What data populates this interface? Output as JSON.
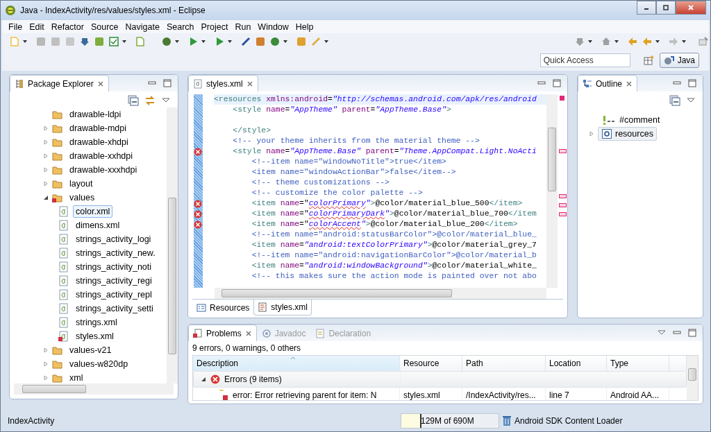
{
  "window": {
    "title": "Java - IndexActivity/res/values/styles.xml - Eclipse"
  },
  "menu": [
    "File",
    "Edit",
    "Refactor",
    "Source",
    "Navigate",
    "Search",
    "Project",
    "Run",
    "Window",
    "Help"
  ],
  "quick_access": {
    "placeholder": "Quick Access"
  },
  "perspective": {
    "label": "Java",
    "selected": true
  },
  "package_explorer": {
    "title": "Package Explorer",
    "tree": [
      {
        "label": "drawable-ldpi",
        "kind": "folder",
        "error": false,
        "selected": false
      },
      {
        "label": "drawable-mdpi",
        "kind": "folder",
        "expanded": false,
        "error": false,
        "selected": false
      },
      {
        "label": "drawable-xhdpi",
        "kind": "folder",
        "expanded": false,
        "error": false,
        "selected": false
      },
      {
        "label": "drawable-xxhdpi",
        "kind": "folder",
        "expanded": false,
        "error": false,
        "selected": false
      },
      {
        "label": "drawable-xxxhdpi",
        "kind": "folder",
        "expanded": false,
        "error": false,
        "selected": false
      },
      {
        "label": "layout",
        "kind": "folder",
        "expanded": false,
        "error": false,
        "selected": false
      },
      {
        "label": "values",
        "kind": "folder",
        "expanded": true,
        "error": true,
        "selected": false,
        "children": [
          {
            "label": "color.xml",
            "kind": "file",
            "error": false,
            "selected": true
          },
          {
            "label": "dimens.xml",
            "kind": "file",
            "error": false,
            "selected": false
          },
          {
            "label": "strings_activity_logi",
            "kind": "file",
            "error": false,
            "selected": false
          },
          {
            "label": "strings_activity_new.",
            "kind": "file",
            "error": false,
            "selected": false
          },
          {
            "label": "strings_activity_noti",
            "kind": "file",
            "error": false,
            "selected": false
          },
          {
            "label": "strings_activity_regi",
            "kind": "file",
            "error": false,
            "selected": false
          },
          {
            "label": "strings_activity_repl",
            "kind": "file",
            "error": false,
            "selected": false
          },
          {
            "label": "strings_activity_setti",
            "kind": "file",
            "error": false,
            "selected": false
          },
          {
            "label": "strings.xml",
            "kind": "file",
            "error": false,
            "selected": false
          },
          {
            "label": "styles.xml",
            "kind": "file",
            "error": true,
            "selected": false
          }
        ]
      },
      {
        "label": "values-v21",
        "kind": "folder",
        "expanded": false,
        "error": false,
        "selected": false
      },
      {
        "label": "values-w820dp",
        "kind": "folder",
        "expanded": false,
        "error": false,
        "selected": false
      },
      {
        "label": "xml",
        "kind": "folder",
        "expanded": false,
        "error": false,
        "selected": false
      }
    ]
  },
  "editor": {
    "tabs": [
      {
        "label": "styles.xml",
        "selected": true
      }
    ],
    "lines": [
      {
        "kind": "code",
        "error": false,
        "current": true,
        "segments": [
          {
            "kind": "tag",
            "text": "<resources"
          },
          {
            "kind": "attr",
            "text": " xmlns:android"
          },
          {
            "kind": "text",
            "text": "="
          },
          {
            "kind": "value",
            "text": "\"http://schemas.android.com/apk/res/android"
          }
        ]
      },
      {
        "kind": "code",
        "error": false,
        "current": false,
        "segments": [
          {
            "kind": "tag",
            "text": "    <style"
          },
          {
            "kind": "attr",
            "text": " name"
          },
          {
            "kind": "text",
            "text": "="
          },
          {
            "kind": "value",
            "text": "\"AppTheme\""
          },
          {
            "kind": "attr",
            "text": " parent"
          },
          {
            "kind": "text",
            "text": "="
          },
          {
            "kind": "value",
            "text": "\"AppTheme.Base\""
          },
          {
            "kind": "tag",
            "text": ">"
          }
        ]
      },
      {
        "kind": "blank"
      },
      {
        "kind": "code",
        "error": false,
        "current": false,
        "segments": [
          {
            "kind": "tag",
            "text": "    </style>"
          }
        ]
      },
      {
        "kind": "code",
        "error": false,
        "current": false,
        "segments": [
          {
            "kind": "comment",
            "text": "    <!-- your theme inherits from the material theme -->"
          }
        ]
      },
      {
        "kind": "code",
        "error": true,
        "current": false,
        "segments": [
          {
            "kind": "tag",
            "text": "    <style"
          },
          {
            "kind": "attr",
            "text": " name"
          },
          {
            "kind": "text",
            "text": "="
          },
          {
            "kind": "value",
            "text": "\"AppTheme.Base\""
          },
          {
            "kind": "attr",
            "text": " parent"
          },
          {
            "kind": "text",
            "text": "="
          },
          {
            "kind": "value",
            "text": "\"Theme.AppCompat.Light.NoActi"
          }
        ]
      },
      {
        "kind": "code",
        "error": false,
        "current": false,
        "segments": [
          {
            "kind": "comment",
            "text": "        <!--item name=\"windowNoTitle\">true</item>"
          }
        ]
      },
      {
        "kind": "code",
        "error": false,
        "current": false,
        "segments": [
          {
            "kind": "comment",
            "text": "        <item name=\"windowActionBar\">false</item-->"
          }
        ]
      },
      {
        "kind": "code",
        "error": false,
        "current": false,
        "segments": [
          {
            "kind": "comment",
            "text": "        <!-- theme customizations -->"
          }
        ]
      },
      {
        "kind": "code",
        "error": false,
        "current": false,
        "segments": [
          {
            "kind": "comment",
            "text": "        <!-- customize the color palette -->"
          }
        ]
      },
      {
        "kind": "code",
        "error": true,
        "current": false,
        "segments": [
          {
            "kind": "tag",
            "text": "        <item"
          },
          {
            "kind": "attr",
            "text": " name"
          },
          {
            "kind": "text",
            "text": "=\""
          },
          {
            "kind": "value",
            "text": "colorPrimary",
            "squiggle": true
          },
          {
            "kind": "value",
            "text": "\""
          },
          {
            "kind": "tag",
            "text": ">"
          },
          {
            "kind": "text",
            "text": "@color/material_blue_500"
          },
          {
            "kind": "tag",
            "text": "</item>"
          }
        ]
      },
      {
        "kind": "code",
        "error": true,
        "current": false,
        "segments": [
          {
            "kind": "tag",
            "text": "        <item"
          },
          {
            "kind": "attr",
            "text": " name"
          },
          {
            "kind": "text",
            "text": "=\""
          },
          {
            "kind": "value",
            "text": "colorPrimaryDark",
            "squiggle": true
          },
          {
            "kind": "value",
            "text": "\""
          },
          {
            "kind": "tag",
            "text": ">"
          },
          {
            "kind": "text",
            "text": "@color/material_blue_700"
          },
          {
            "kind": "tag",
            "text": "</item"
          }
        ]
      },
      {
        "kind": "code",
        "error": true,
        "current": false,
        "segments": [
          {
            "kind": "tag",
            "text": "        <item"
          },
          {
            "kind": "attr",
            "text": " name"
          },
          {
            "kind": "text",
            "text": "=\""
          },
          {
            "kind": "value",
            "text": "colorAccent",
            "squiggle": true
          },
          {
            "kind": "value",
            "text": "\""
          },
          {
            "kind": "tag",
            "text": ">"
          },
          {
            "kind": "text",
            "text": "@color/material_blue_200"
          },
          {
            "kind": "tag",
            "text": "</item>"
          }
        ]
      },
      {
        "kind": "code",
        "error": false,
        "current": false,
        "segments": [
          {
            "kind": "comment",
            "text": "        <!--item name=\"android:statusBarColor\">@color/material_blue_"
          }
        ]
      },
      {
        "kind": "code",
        "error": false,
        "current": false,
        "segments": [
          {
            "kind": "tag",
            "text": "        <item"
          },
          {
            "kind": "attr",
            "text": " name"
          },
          {
            "kind": "text",
            "text": "="
          },
          {
            "kind": "value",
            "text": "\"android:textColorPrimary\""
          },
          {
            "kind": "tag",
            "text": ">"
          },
          {
            "kind": "text",
            "text": "@color/material_grey_7"
          }
        ]
      },
      {
        "kind": "code",
        "error": false,
        "current": false,
        "segments": [
          {
            "kind": "comment",
            "text": "        <!--item name=\"android:navigationBarColor\">@color/material_b"
          }
        ]
      },
      {
        "kind": "code",
        "error": false,
        "current": false,
        "segments": [
          {
            "kind": "tag",
            "text": "        <item"
          },
          {
            "kind": "attr",
            "text": " name"
          },
          {
            "kind": "text",
            "text": "="
          },
          {
            "kind": "value",
            "text": "\"android:windowBackground\""
          },
          {
            "kind": "tag",
            "text": ">"
          },
          {
            "kind": "text",
            "text": "@color/material_white_"
          }
        ]
      },
      {
        "kind": "code",
        "error": false,
        "current": false,
        "segments": [
          {
            "kind": "comment",
            "text": "        <!-- this makes sure the action mode is painted over not abo"
          }
        ]
      }
    ],
    "bottom_tabs": [
      {
        "label": "Resources",
        "kind": "form",
        "selected": false
      },
      {
        "label": "styles.xml",
        "kind": "source",
        "selected": true
      }
    ]
  },
  "outline": {
    "title": "Outline",
    "items": [
      {
        "kind": "comment",
        "label": "#comment",
        "selected": false
      },
      {
        "kind": "element",
        "label": "resources",
        "expanded": false,
        "selected": true
      }
    ]
  },
  "problems": {
    "tabs": [
      {
        "label": "Problems",
        "kind": "problems",
        "selected": true
      },
      {
        "label": "Javadoc",
        "kind": "javadoc",
        "selected": false
      },
      {
        "label": "Declaration",
        "kind": "declaration",
        "selected": false
      }
    ],
    "summary": "9 errors, 0 warnings, 0 others",
    "columns": [
      {
        "label": "Description",
        "sorted": true
      },
      {
        "label": "Resource",
        "sorted": false
      },
      {
        "label": "Path",
        "sorted": false
      },
      {
        "label": "Location",
        "sorted": false
      },
      {
        "label": "Type",
        "sorted": false
      }
    ],
    "groups": [
      {
        "label": "Errors (9 items)",
        "expanded": true,
        "rows": [
          [
            "error: Error retrieving parent for item: N",
            "styles.xml",
            "/IndexActivity/res...",
            "line 7",
            "Android AA..."
          ]
        ]
      }
    ]
  },
  "status_bar": {
    "selection": "IndexActivity",
    "memory": {
      "text": "129M of 690M",
      "level": 0.19
    },
    "job": "Android SDK Content Loader"
  }
}
